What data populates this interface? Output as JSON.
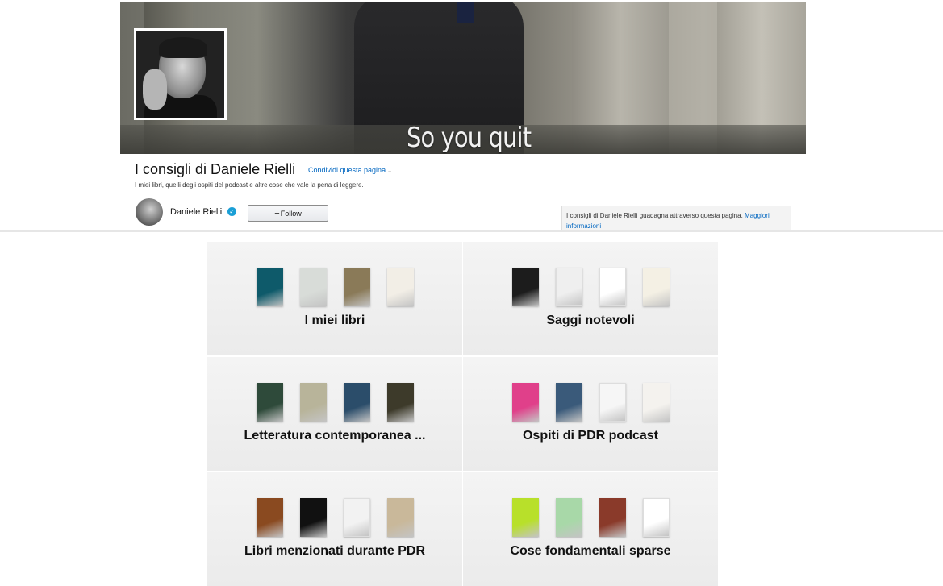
{
  "banner": {
    "caption": "So you quit"
  },
  "header": {
    "title": "I consigli di Daniele Rielli",
    "share_label": "Condividi questa pagina",
    "subtitle": "I miei libri, quelli degli ospiti del podcast e altre cose che vale la pena di leggere."
  },
  "author": {
    "name": "Daniele Rielli",
    "follow_label": "Follow"
  },
  "disclosure": {
    "text": "I consigli di Daniele Rielli guadagna attraverso questa pagina.",
    "link": "Maggiori informazioni"
  },
  "colors": {
    "link": "#0066c0",
    "verified": "#1a9fd6",
    "tile_bg": "#efefef"
  },
  "tiles": [
    {
      "label": "I miei libri",
      "covers": [
        "#0e5a6a",
        "#d8dcd8",
        "#8a7a58",
        "#f2eee6"
      ]
    },
    {
      "label": "Saggi notevoli",
      "covers": [
        "#1c1c1c",
        "#efefef",
        "#ffffff",
        "#f4f0e4"
      ]
    },
    {
      "label": "Letteratura contemporanea ...",
      "covers": [
        "#2e4a3a",
        "#b8b49a",
        "#2b4d6a",
        "#3d3a2a"
      ]
    },
    {
      "label": "Ospiti di PDR podcast",
      "covers": [
        "#e0408a",
        "#3a5a7a",
        "#f6f6f6",
        "#f4f2ee"
      ]
    },
    {
      "label": "Libri menzionati durante PDR",
      "covers": [
        "#8a4a20",
        "#111111",
        "#f2f2f2",
        "#c9b89a"
      ]
    },
    {
      "label": "Cose fondamentali sparse",
      "covers": [
        "#b8e02a",
        "#a8d8a8",
        "#8a3a2a",
        "#ffffff"
      ]
    }
  ]
}
